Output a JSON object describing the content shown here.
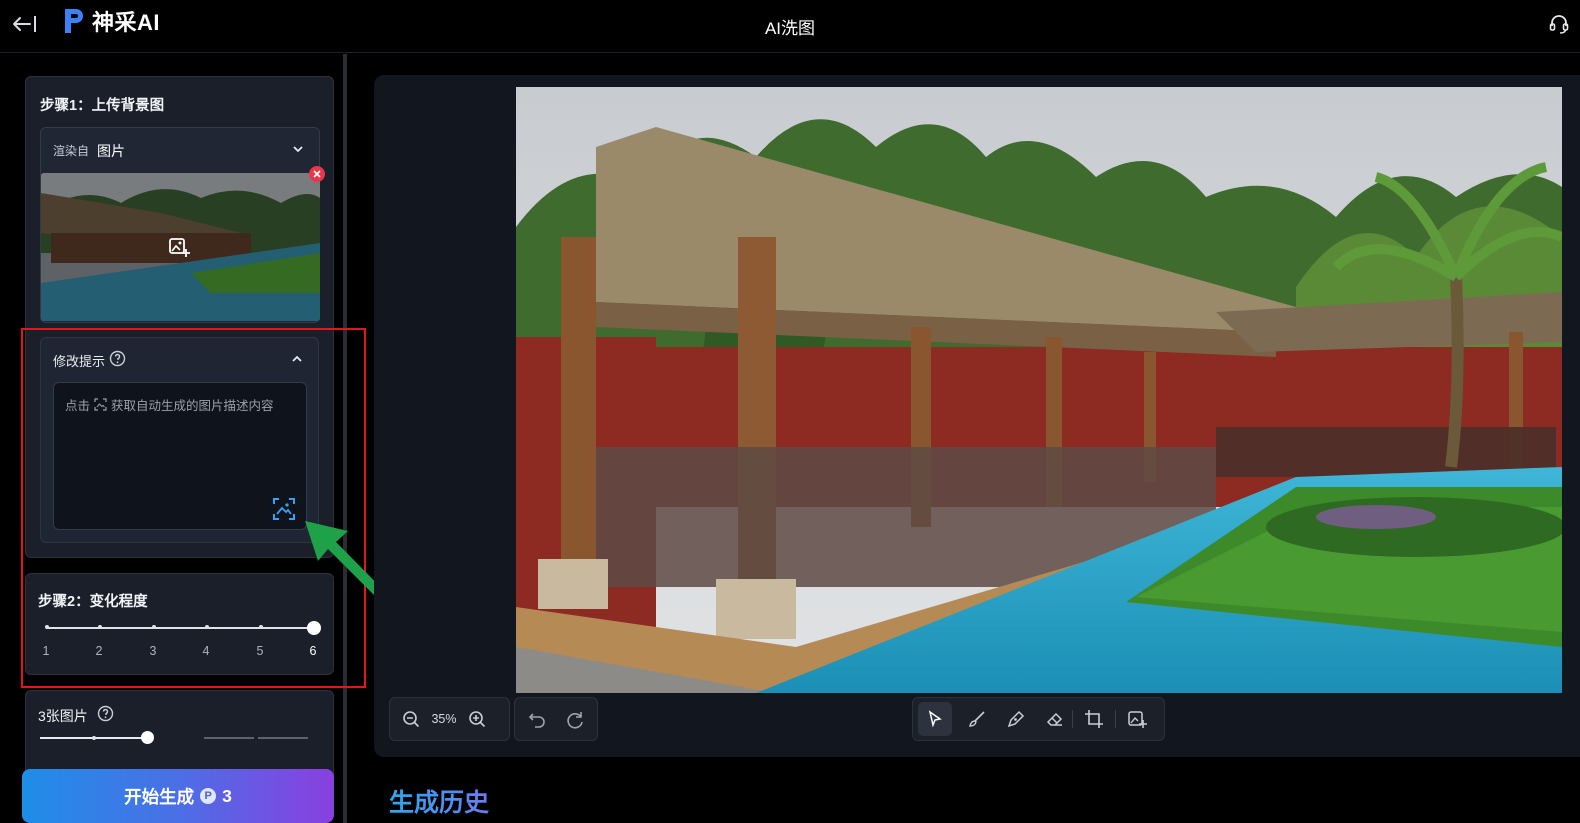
{
  "header": {
    "brand": "神采AI",
    "title": "AI洗图"
  },
  "step1": {
    "title": "步骤1：上传背景图",
    "render_from_label": "渲染自",
    "render_from_value": "图片"
  },
  "prompt": {
    "title": "修改提示",
    "placeholder_prefix": "点击",
    "placeholder_suffix": "获取自动生成的图片描述内容"
  },
  "step2": {
    "title": "步骤2：变化程度",
    "ticks": [
      "1",
      "2",
      "3",
      "4",
      "5",
      "6"
    ],
    "selected_level": 6
  },
  "count": {
    "title": "3张图片",
    "selected_fraction": 0.4
  },
  "generate": {
    "label": "开始生成",
    "credits": "3"
  },
  "canvas": {
    "zoom": "35%"
  },
  "history": {
    "title": "生成历史"
  },
  "colors": {
    "annotation_box": "#e5151c",
    "annotation_arrow": "#1fa14a",
    "accent_blue": "#2fa6ef",
    "remove_red": "#e8364c"
  }
}
